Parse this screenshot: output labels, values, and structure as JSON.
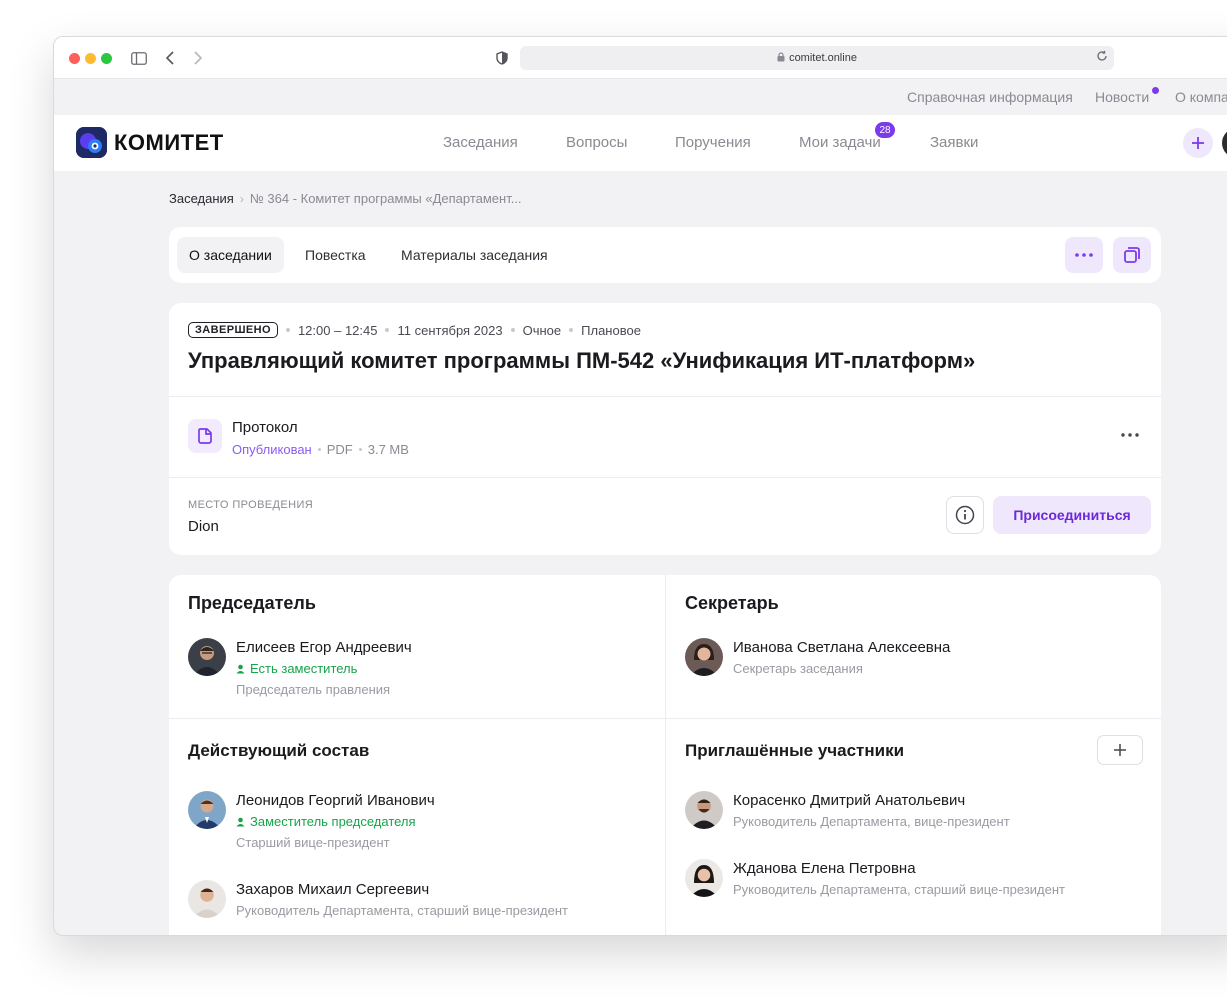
{
  "browser": {
    "url": "comitet.online"
  },
  "topnav": {
    "items": [
      "Справочная информация",
      "Новости",
      "О компа"
    ]
  },
  "header": {
    "logo_text": "КОМИТЕТ",
    "nav": [
      "Заседания",
      "Вопросы",
      "Поручения",
      "Мои задачи",
      "Заявки"
    ],
    "tasks_badge": "28"
  },
  "breadcrumb": {
    "root": "Заседания",
    "current": "№ 364 - Комитет программы «Департамент..."
  },
  "tabs": [
    "О заседании",
    "Повестка",
    "Материалы заседания"
  ],
  "meeting": {
    "status": "ЗАВЕРШЕНО",
    "time": "12:00 – 12:45",
    "date": "11 сентября 2023",
    "format": "Очное",
    "kind": "Плановое",
    "title": "Управляющий комитет программы ПМ-542 «Унификация ИТ-платформ»",
    "document": {
      "title": "Протокол",
      "status": "Опубликован",
      "type": "PDF",
      "size": "3.7 MB"
    },
    "venue_label": "МЕСТО ПРОВЕДЕНИЯ",
    "venue": "Dion",
    "join_label": "Присоединиться"
  },
  "chair": {
    "title": "Председатель",
    "name": "Елисеев Егор Андреевич",
    "tag": "Есть заместитель",
    "role": "Председатель правления"
  },
  "secretary": {
    "title": "Секретарь",
    "name": "Иванова Светлана Алексеевна",
    "role": "Секретарь заседания"
  },
  "members": {
    "title": "Действующий состав",
    "people": [
      {
        "name": "Леонидов Георгий Иванович",
        "tag": "Заместитель председателя",
        "role": "Старший вице-президент"
      },
      {
        "name": "Захаров Михаил Сергеевич",
        "role": "Руководитель Департамента, старший вице-президент"
      }
    ]
  },
  "invited": {
    "title": "Приглашённые участники",
    "people": [
      {
        "name": "Корасенко Дмитрий Анатольевич",
        "role": "Руководитель Департамента, вице-президент"
      },
      {
        "name": "Жданова Елена Петровна",
        "role": "Руководитель Департамента, старший вице-президент"
      }
    ]
  },
  "colors": {
    "accent": "#7c3aed",
    "accent_soft": "#efe8fd",
    "success": "#16a34a",
    "muted": "#8a8a92"
  }
}
